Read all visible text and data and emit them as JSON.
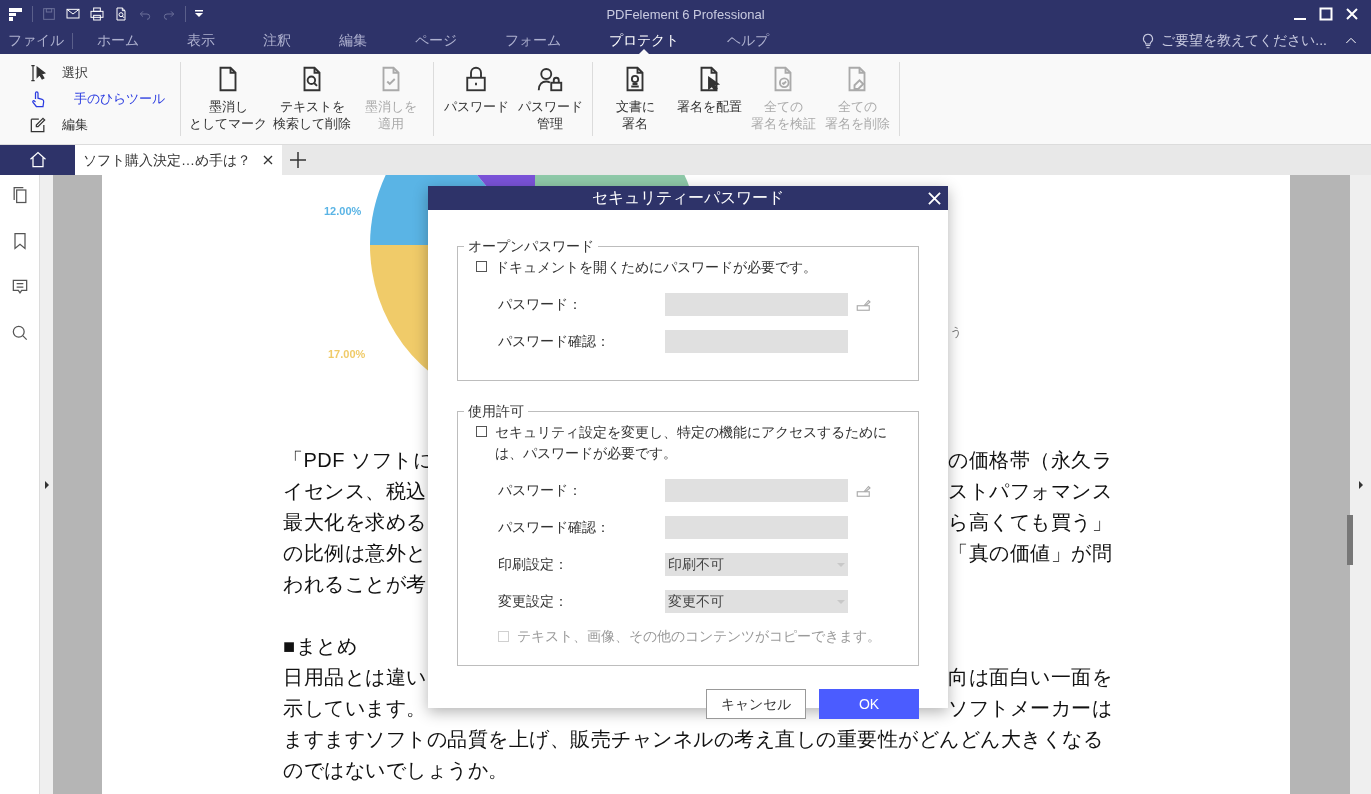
{
  "window": {
    "title": "PDFelement 6 Professional"
  },
  "menu_tabs": [
    {
      "label": "ファイル",
      "selected": false
    },
    {
      "label": "ホーム",
      "selected": false
    },
    {
      "label": "表示",
      "selected": false
    },
    {
      "label": "注釈",
      "selected": false
    },
    {
      "label": "編集",
      "selected": false
    },
    {
      "label": "ページ",
      "selected": false
    },
    {
      "label": "フォーム",
      "selected": false
    },
    {
      "label": "プロテクト",
      "selected": true
    },
    {
      "label": "ヘルプ",
      "selected": false
    }
  ],
  "help_search": {
    "placeholder": "ご要望を教えてください..."
  },
  "ribbon": {
    "tools": [
      {
        "label": "選択",
        "selected": false
      },
      {
        "label": "手のひらツール",
        "selected": true
      },
      {
        "label": "編集",
        "selected": false
      }
    ],
    "groups": [
      [
        {
          "lines": [
            "墨消し",
            "としてマーク"
          ],
          "disabled": false
        },
        {
          "lines": [
            "テキストを",
            "検索して削除"
          ],
          "disabled": false
        },
        {
          "lines": [
            "墨消しを",
            "適用"
          ],
          "disabled": true
        }
      ],
      [
        {
          "lines": [
            "パスワード"
          ],
          "disabled": false
        },
        {
          "lines": [
            "パスワード",
            "管理"
          ],
          "disabled": false
        }
      ],
      [
        {
          "lines": [
            "文書に",
            "署名"
          ],
          "disabled": false
        },
        {
          "lines": [
            "署名を配置"
          ],
          "disabled": false
        },
        {
          "lines": [
            "全ての",
            "署名を検証"
          ],
          "disabled": true
        },
        {
          "lines": [
            "全ての",
            "署名を削除"
          ],
          "disabled": true
        }
      ]
    ]
  },
  "document_tab": {
    "title": "ソフト購入決定…め手は？",
    "selected": true
  },
  "document": {
    "chart_labels": [
      {
        "text": "12.00%",
        "color": "#5ab4e5"
      },
      {
        "text": "17.00%",
        "color": "#f0cb69"
      }
    ],
    "legend_fragment": "う",
    "lines": [
      {
        "left": "「PDF ソフトに",
        "right": "の価格帯（永久ラ"
      },
      {
        "left": "イセンス、税込",
        "right": "ストパフォマンス"
      },
      {
        "left": "最大化を求める",
        "right": "ら高くても買う」"
      },
      {
        "left": "の比例は意外と",
        "right": "「真の価値」が問"
      },
      {
        "left": "われることが考"
      },
      {
        "left": "■まとめ",
        "gap_before": true
      },
      {
        "left": "日用品とは違い",
        "right": "向は面白い一面を"
      },
      {
        "left": "示しています。",
        "right": "ソフトメーカーは"
      },
      {
        "left": "ますますソフトの品質を上げ、販売チャンネルの考え直しの重要性がどんどん大きくなる"
      },
      {
        "left": "のではないでしょうか。"
      }
    ]
  },
  "dialog": {
    "title": "セキュリティーパスワード",
    "open_password": {
      "legend": "オープンパスワード",
      "checkbox": {
        "label": "ドキュメントを開くためにパスワードが必要です。",
        "checked": false
      },
      "fields": [
        {
          "label": "パスワード：",
          "kind": "password"
        },
        {
          "label": "パスワード確認：",
          "kind": "confirm"
        }
      ]
    },
    "permissions": {
      "legend": "使用許可",
      "checkbox": {
        "label": "セキュリティ設定を変更し、特定の機能にアクセスするためには、パスワードが必要です。",
        "checked": false
      },
      "fields": [
        {
          "label": "パスワード：",
          "kind": "password"
        },
        {
          "label": "パスワード確認：",
          "kind": "confirm"
        },
        {
          "label": "印刷設定：",
          "kind": "select",
          "value": "印刷不可"
        },
        {
          "label": "変更設定：",
          "kind": "select",
          "value": "変更不可"
        }
      ],
      "copy_checkbox": {
        "label": "テキスト、画像、その他のコンテンツがコピーできます。",
        "checked": false,
        "disabled": true
      }
    },
    "buttons": [
      {
        "label": "キャンセル",
        "kind": "secondary"
      },
      {
        "label": "OK",
        "kind": "primary"
      }
    ]
  }
}
